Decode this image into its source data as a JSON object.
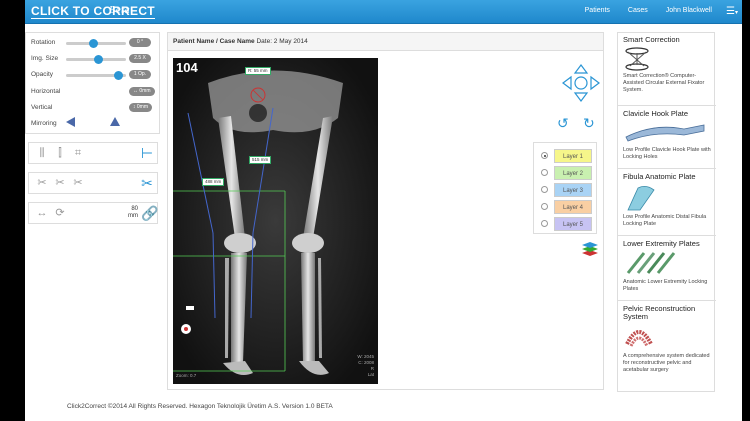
{
  "navbar": {
    "brand": "CLICK TO CORRECT",
    "beta": "Beta",
    "links": [
      "Patients",
      "Cases",
      "John Blackwell"
    ],
    "menu_icon": "hamburger-icon"
  },
  "controls": {
    "rotation": {
      "label": "Rotation",
      "value": "0 °",
      "level": 0.45
    },
    "img_size": {
      "label": "Img. Size",
      "value": "2.5 X",
      "level": 0.55
    },
    "opacity": {
      "label": "Opacity",
      "value": "1 Op.",
      "level": 0.95
    },
    "horizontal": {
      "label": "Horizontal",
      "value": "↔ 0mm"
    },
    "vertical": {
      "label": "Vertical",
      "value": "↕ 0mm"
    },
    "mirroring": {
      "label": "Mirroring"
    },
    "link_value": "80",
    "link_unit": "mm"
  },
  "viewer": {
    "patient_label": "Patient Name / Case Name",
    "date": "Date: 2 May 2014",
    "frame_number": "104",
    "measurements": [
      "R: 55 mm",
      "515 mm",
      "488 mm"
    ],
    "corner_info": [
      "W: 2045",
      "C: 2008",
      "R",
      "Lat"
    ],
    "zoom_info": "Zoom: 0.7"
  },
  "layers": [
    "Layer 1",
    "Layer 2",
    "Layer 3",
    "Layer 4",
    "Layer 5"
  ],
  "layer_colors": [
    "#f6f68a",
    "#c9f0b0",
    "#a9d3f5",
    "#f9cfa3",
    "#c7c3f3"
  ],
  "products": [
    {
      "title": "Smart Correction",
      "desc": "Smart Correction® Computer-Assisted Circular External Fixator System."
    },
    {
      "title": "Clavicle Hook Plate",
      "desc": "Low Profile Clavicle Hook Plate with Locking Holes"
    },
    {
      "title": "Fibula Anatomic Plate",
      "desc": "Low Profile Anatomic Distal Fibula Locking Plate"
    },
    {
      "title": "Lower Extremity Plates",
      "desc": "Anatomic Lower Extremity Locking Plates"
    },
    {
      "title": "Pelvic Reconstruction System",
      "desc": "A comprehensive system dedicated for reconstructive pelvic and acetabular surgery"
    }
  ],
  "footer": "Click2Correct ©2014 All Rights Reserved. Hexagon Teknolojik Üretim A.S. Version 1.0 BETA",
  "accent": "#2a95d4"
}
